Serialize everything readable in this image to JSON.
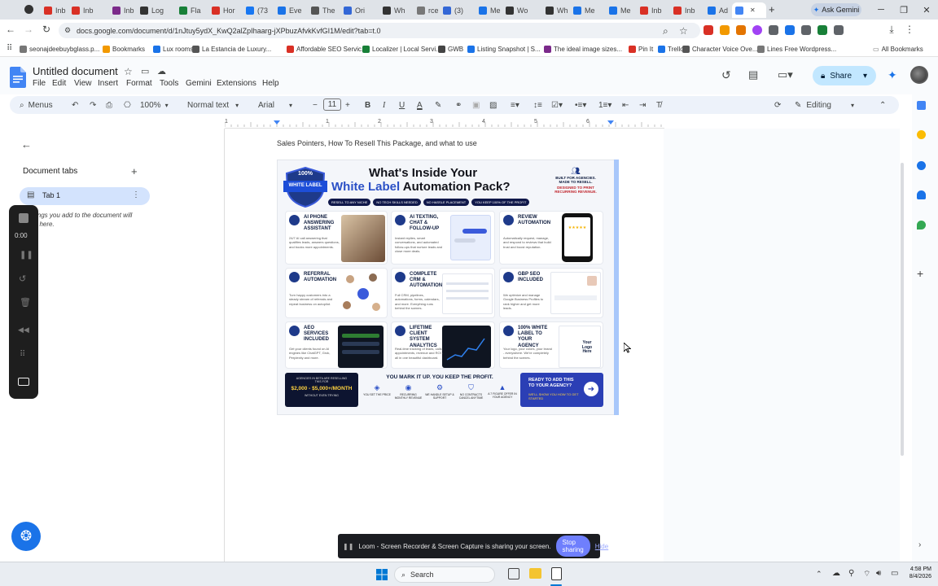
{
  "browser": {
    "tabs": [
      {
        "label": "Inb",
        "color": "#d93025"
      },
      {
        "label": "Inb",
        "color": "#d93025"
      },
      {
        "label": "Inb",
        "color": "#7b2a8a"
      },
      {
        "label": "Log",
        "color": "#333333"
      },
      {
        "label": "Fla",
        "color": "#188038"
      },
      {
        "label": "Hor",
        "color": "#d93025"
      },
      {
        "label": "(73",
        "color": "#1877f2"
      },
      {
        "label": "Eve",
        "color": "#1a73e8"
      },
      {
        "label": "The",
        "color": "#555555"
      },
      {
        "label": "Ori",
        "color": "#3367d6"
      },
      {
        "label": "Wh",
        "color": "#333333"
      },
      {
        "label": "rce",
        "color": "#777777"
      },
      {
        "label": "(3)",
        "color": "#3367d6"
      },
      {
        "label": "Me",
        "color": "#1a73e8"
      },
      {
        "label": "Wo",
        "color": "#333333"
      },
      {
        "label": "Wh",
        "color": "#333333"
      },
      {
        "label": "Me",
        "color": "#1a73e8"
      },
      {
        "label": "Me",
        "color": "#1a73e8"
      },
      {
        "label": "Inb",
        "color": "#d93025"
      },
      {
        "label": "Inb",
        "color": "#d93025"
      },
      {
        "label": "Ad",
        "color": "#1a73e8"
      },
      {
        "label": "",
        "color": "#4285f4",
        "active": true
      }
    ],
    "new_tab": "+",
    "ask_gemini": "Ask Gemini",
    "url": "docs.google.com/document/d/1nJtuy5ydX_KwQ2alZpIhaarg-jXPbuzAfvkKvfGI1M/edit?tab=t.0",
    "bookmarks": [
      {
        "label": "seonajdeebuybglass.p..."
      },
      {
        "label": "Bookmarks"
      },
      {
        "label": "Lux rooms"
      },
      {
        "label": "La Estancia de Luxury..."
      },
      {
        "label": "Affordable SEO Servic..."
      },
      {
        "label": "Localizer | Local Servi..."
      },
      {
        "label": "GWB"
      },
      {
        "label": "Listing Snapshot | S..."
      },
      {
        "label": "The ideal image sizes..."
      },
      {
        "label": "Pin It"
      },
      {
        "label": "Trello"
      },
      {
        "label": "Character Voice Ove..."
      },
      {
        "label": "Lines Free Wordpress..."
      }
    ],
    "all_bookmarks": "All Bookmarks"
  },
  "docs": {
    "title": "Untitled document",
    "menu": [
      "File",
      "Edit",
      "View",
      "Insert",
      "Format",
      "Tools",
      "Gemini",
      "Extensions",
      "Help"
    ],
    "share": "Share",
    "toolbar": {
      "menus": "Menus",
      "zoom": "100%",
      "style": "Normal text",
      "font": "Arial",
      "font_size": "11",
      "mode": "Editing"
    },
    "ruler_marks": [
      "1",
      "1",
      "2",
      "3",
      "4",
      "5",
      "6"
    ],
    "sidebar": {
      "document_tabs": "Document tabs",
      "tab_name": "Tab 1",
      "hint": "ings you add to the document will\nt here."
    },
    "recorder_time": "0:00",
    "body_text": "Sales Pointers, How To Resell This Package, and what to use"
  },
  "infographic": {
    "badge_top": "100%",
    "badge_main": "WHITE LABEL",
    "title_line1": "What's Inside Your",
    "title_line2_a": "White Label",
    "title_line2_b": "Automation Pack?",
    "agency_head": "BUILT FOR AGENCIES. MADE TO RESELL.",
    "agency_sub": "DESIGNED TO PRINT RECURRING REVENUE.",
    "pills": [
      "RESELL TO ANY NICHE",
      "NO TECH SKILLS NEEDED",
      "NO HASSLE PLACEMENT",
      "YOU KEEP 100% OF THE PROFIT"
    ],
    "cards": [
      {
        "head": "AI PHONE ANSWERING ASSISTANT",
        "text": "24/7 AI call answering that qualifies leads, answers questions, and books more appointments."
      },
      {
        "head": "AI TEXTING, CHAT & FOLLOW-UP",
        "text": "Instant replies, smart conversations, and automated follow-ups that nurture leads and close more deals."
      },
      {
        "head": "REVIEW AUTOMATION",
        "text": "Automatically request, manage, and respond to reviews that build trust and boost reputation."
      },
      {
        "head": "REFERRAL AUTOMATION",
        "text": "Turn happy customers into a steady stream of referrals and repeat business on autopilot."
      },
      {
        "head": "COMPLETE CRM & AUTOMATION",
        "text": "Full CRM, pipelines, automations, forms, calendars, and more. Everything runs behind the scenes."
      },
      {
        "head": "GBP SEO INCLUDED",
        "text": "We optimize and manage Google Business Profiles to rank higher and get more leads."
      },
      {
        "head": "AEO SERVICES INCLUDED",
        "text": "Get your clients found on AI engines like ChatGPT, Grok, Perplexity and more."
      },
      {
        "head": "LIFETIME CLIENT SYSTEM ANALYTICS",
        "text": "Real-time tracking of leads, calls, appointments, revenue and ROI - all in one beautiful dashboard."
      },
      {
        "head": "100% WHITE LABEL TO YOUR AGENCY",
        "text": "Your logo, your colors, your brand - everywhere. We're completely behind the scenes."
      }
    ],
    "logo_here": "Your Logo Here",
    "profit_small": "AGENCIES IN BETA ARE RESELLING THIS FOR",
    "profit_range": "$2,000 - $5,000+/MONTH",
    "profit_sub": "WITHOUT EVEN TRYING",
    "markup_title": "YOU MARK IT UP. YOU KEEP THE PROFIT.",
    "benefits": [
      "YOU SET THE PRICE",
      "RECURRING MONTHLY REVENUE",
      "WE HANDLE SETUP & SUPPORT",
      "NO CONTRACTS CANCEL ANYTIME",
      "A 7 FIGURE OFFER IN YOUR AGENCY"
    ],
    "cta_line1": "READY TO ADD THIS TO YOUR AGENCY?",
    "cta_line2": "WE'LL SHOW YOU HOW TO GET STARTED"
  },
  "loom": {
    "text": "Loom - Screen Recorder & Screen Capture is sharing your screen.",
    "stop": "Stop sharing",
    "hide": "Hide"
  },
  "taskbar": {
    "search": "Search",
    "time": "4:58 PM",
    "date": "8/4/2026"
  }
}
